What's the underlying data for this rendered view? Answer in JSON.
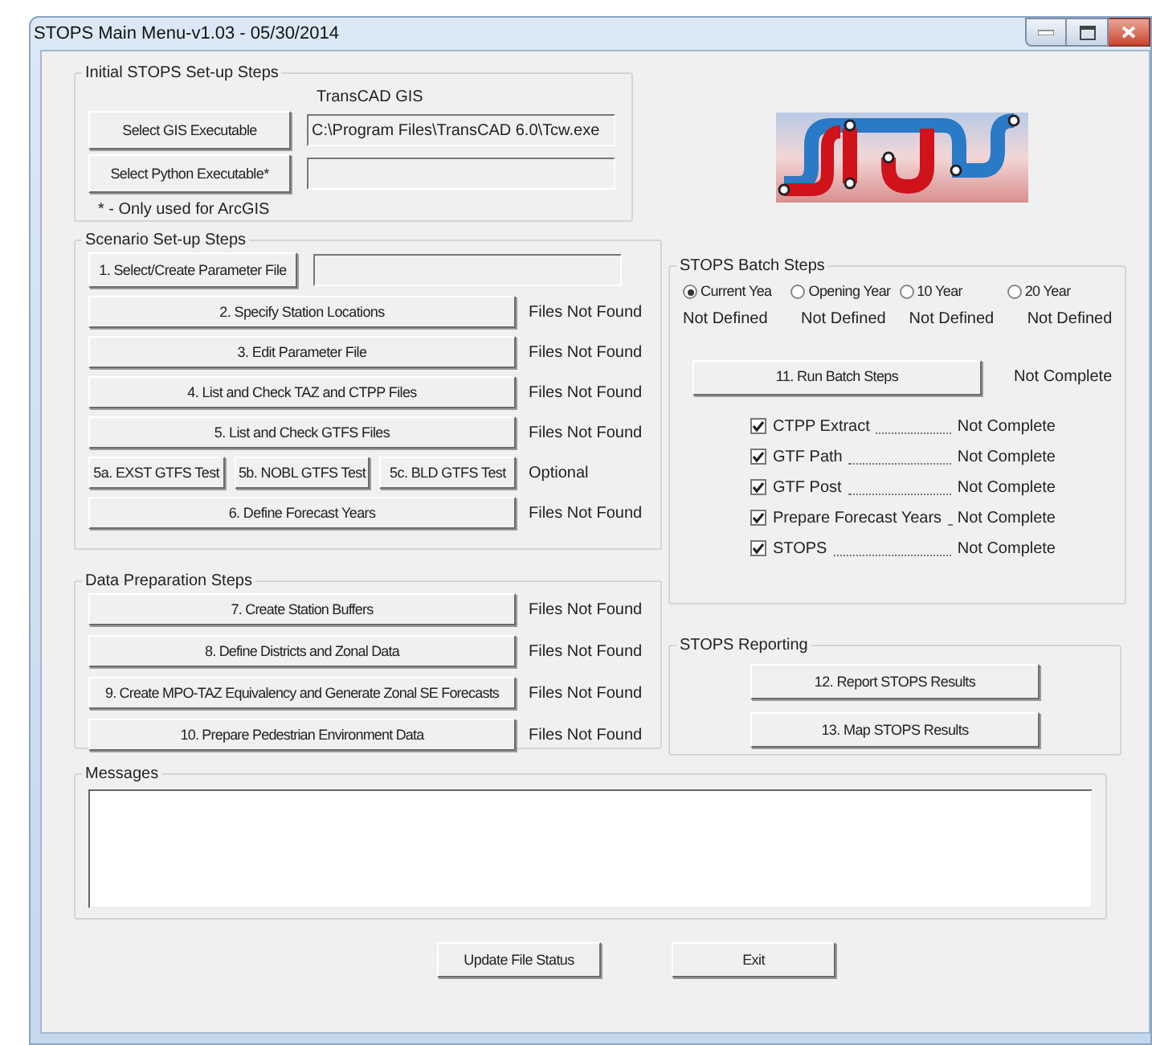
{
  "window": {
    "title": "STOPS Main Menu-v1.03 - 05/30/2014"
  },
  "initial_setup": {
    "title": "Initial STOPS Set-up Steps",
    "gis_label": "TransCAD GIS",
    "rows": [
      {
        "button": "Select GIS Executable",
        "value": "C:\\Program Files\\TransCAD 6.0\\Tcw.exe"
      },
      {
        "button": "Select Python Executable*",
        "value": ""
      }
    ],
    "note": "* - Only used for ArcGIS"
  },
  "scenario_setup": {
    "title": "Scenario Set-up Steps",
    "parameter_button": "1. Select/Create Parameter File",
    "steps": [
      {
        "kind": "single",
        "buttons": [
          "2. Specify Station Locations"
        ],
        "status": "Files Not Found"
      },
      {
        "kind": "single",
        "buttons": [
          "3. Edit Parameter File"
        ],
        "status": "Files Not Found"
      },
      {
        "kind": "single",
        "buttons": [
          "4. List and Check TAZ and CTPP Files"
        ],
        "status": "Files Not Found"
      },
      {
        "kind": "single",
        "buttons": [
          "5. List and Check GTFS Files"
        ],
        "status": "Files Not Found"
      },
      {
        "kind": "triple",
        "buttons": [
          "5a. EXST GTFS Test",
          "5b. NOBL GTFS Test",
          "5c. BLD GTFS Test"
        ],
        "status": "Optional"
      },
      {
        "kind": "single",
        "buttons": [
          "6. Define Forecast Years"
        ],
        "status": "Files Not Found"
      }
    ]
  },
  "data_preparation": {
    "title": "Data Preparation Steps",
    "steps": [
      {
        "button": "7. Create Station Buffers",
        "status": "Files Not Found"
      },
      {
        "button": "8. Define Districts and Zonal Data",
        "status": "Files Not Found"
      },
      {
        "button": "9. Create MPO-TAZ Equivalency and Generate Zonal SE Forecasts",
        "status": "Files Not Found"
      },
      {
        "button": "10. Prepare Pedestrian Environment Data",
        "status": "Files Not Found"
      }
    ]
  },
  "batch_steps": {
    "title": "STOPS Batch Steps",
    "years": [
      {
        "label": "Current Yea",
        "status": "Not Defined",
        "selected": true
      },
      {
        "label": "Opening Year",
        "status": "Not Defined",
        "selected": false
      },
      {
        "label": "10 Year",
        "status": "Not Defined",
        "selected": false
      },
      {
        "label": "20 Year",
        "status": "Not Defined",
        "selected": false
      }
    ],
    "run_button": "11. Run Batch Steps",
    "run_status": "Not Complete",
    "tasks": [
      {
        "label": "CTPP Extract",
        "status": "Not Complete",
        "checked": true
      },
      {
        "label": "GTF Path",
        "status": "Not Complete",
        "checked": true
      },
      {
        "label": "GTF Post",
        "status": "Not Complete",
        "checked": true
      },
      {
        "label": "Prepare Forecast Years",
        "status": "Not Complete",
        "checked": true
      },
      {
        "label": "STOPS",
        "status": "Not Complete",
        "checked": true
      }
    ]
  },
  "reporting": {
    "title": "STOPS Reporting",
    "buttons": [
      "12. Report STOPS Results",
      "13. Map STOPS Results"
    ]
  },
  "messages": {
    "title": "Messages"
  },
  "footer_buttons": [
    "Update File Status",
    "Exit"
  ]
}
